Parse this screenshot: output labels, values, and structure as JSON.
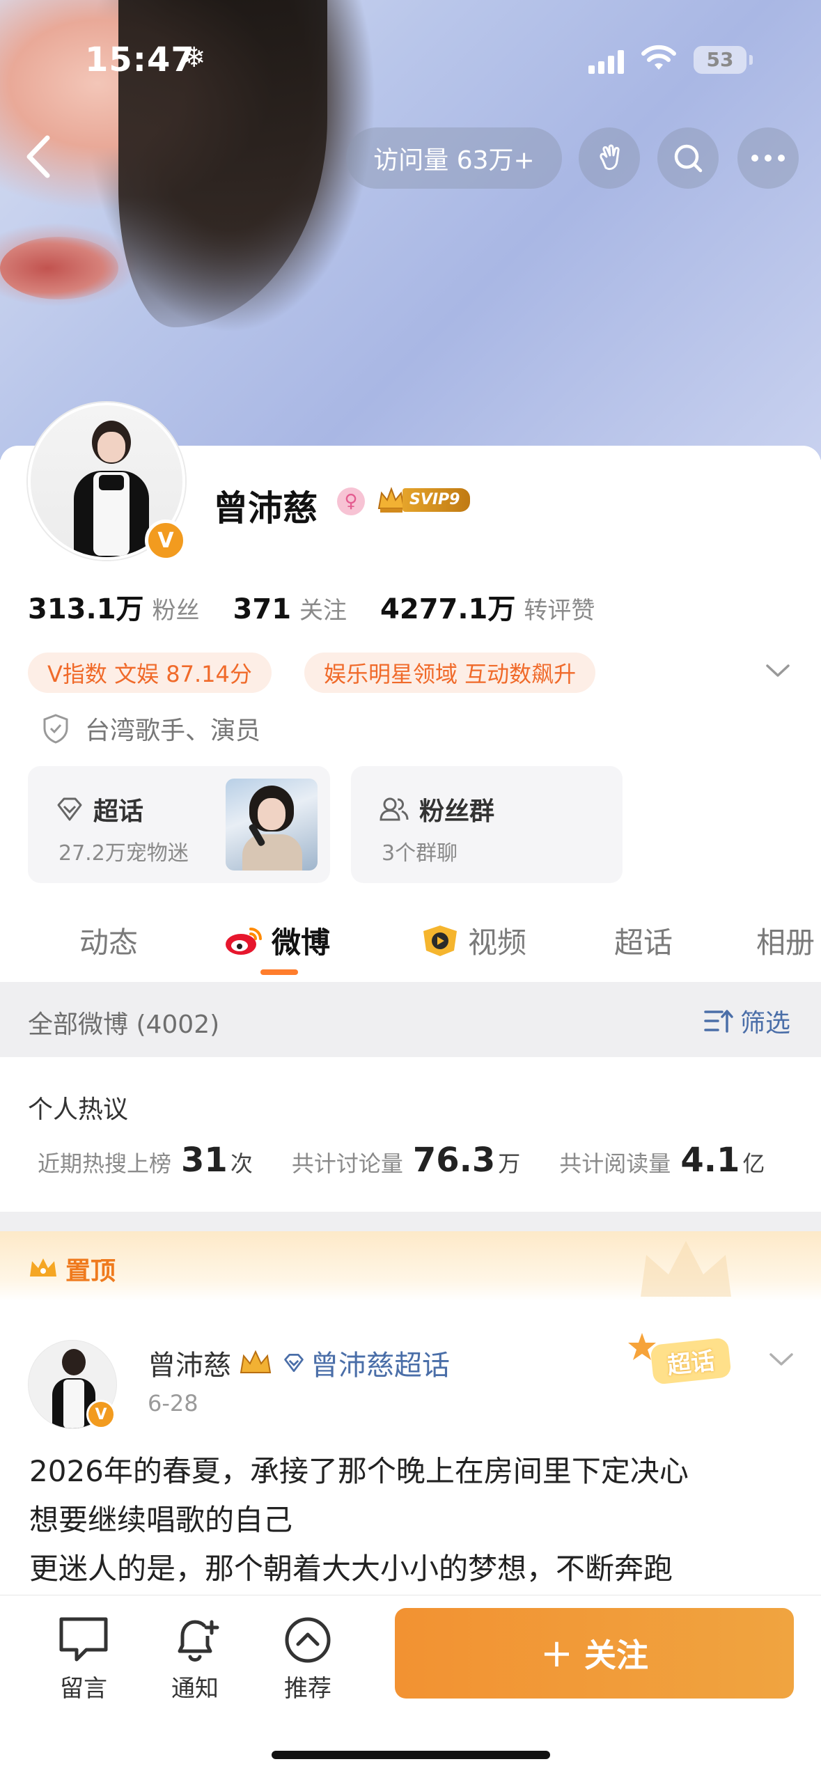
{
  "status_bar": {
    "time": "15:47",
    "weather_icon": "snowflake-icon",
    "battery": "53"
  },
  "header": {
    "visits_label": "访问量 63万+"
  },
  "profile": {
    "name": "曾沛慈",
    "vip_badge": "SVIP9",
    "verified_mark": "V",
    "stats": [
      {
        "value": "313.1万",
        "label": "粉丝"
      },
      {
        "value": "371",
        "label": "关注"
      },
      {
        "value": "4277.1万",
        "label": "转评赞"
      }
    ],
    "chips": [
      "V指数 文娱 87.14分",
      "娱乐明星领域 互动数飙升"
    ],
    "bio": "台湾歌手、演员",
    "supertopic": {
      "title": "超话",
      "sub": "27.2万宠物迷"
    },
    "fan_group": {
      "title": "粉丝群",
      "sub": "3个群聊"
    }
  },
  "tabs": [
    "动态",
    "微博",
    "视频",
    "超话",
    "相册"
  ],
  "filter": {
    "all_label": "全部微博 (4002)",
    "filter_label": "筛选"
  },
  "hot": {
    "title": "个人热议",
    "items": [
      {
        "label": "近期热搜上榜",
        "value": "31",
        "unit": "次"
      },
      {
        "label": "共计讨论量",
        "value": "76.3",
        "unit": "万"
      },
      {
        "label": "共计阅读量",
        "value": "4.1",
        "unit": "亿"
      }
    ]
  },
  "pinned_label": "置顶",
  "post": {
    "author": "曾沛慈",
    "supertopic_link": "曾沛慈超话",
    "stamp": "超话",
    "date": "6-28",
    "lines": [
      "2026年的春夏，承接了那个晚上在房间里下定决心",
      "想要继续唱歌的自己",
      "更迷人的是，那个朝着大大小小的梦想，不断奔跑"
    ]
  },
  "bottom": {
    "comment": "留言",
    "notify": "通知",
    "recommend": "推荐",
    "follow": "关注",
    "follow_plus": "+"
  },
  "colors": {
    "accent": "#ff7d2c",
    "link": "#4a6ea8",
    "follow_button": "#f29232"
  }
}
